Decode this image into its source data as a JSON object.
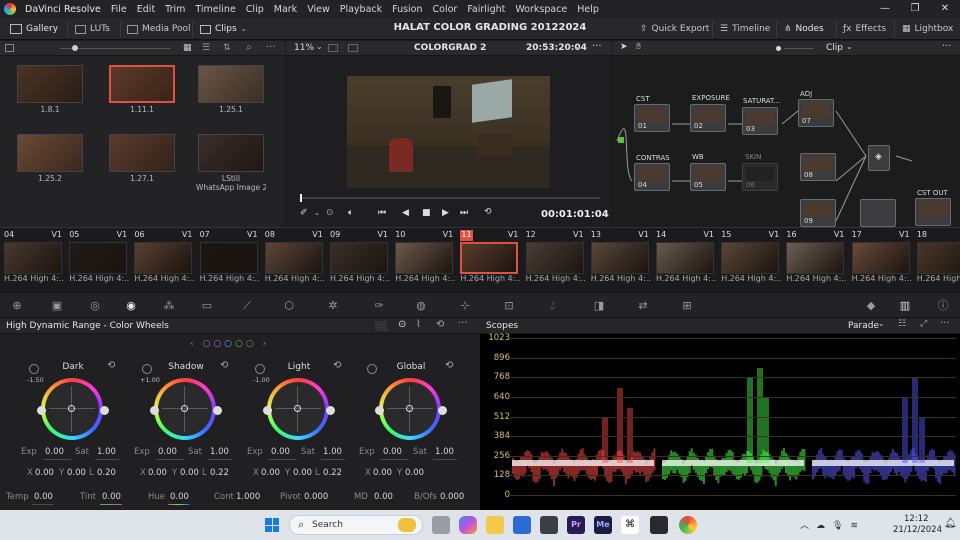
{
  "menubar": {
    "app_name": "DaVinci Resolve",
    "items": [
      "File",
      "Edit",
      "Trim",
      "Timeline",
      "Clip",
      "Mark",
      "View",
      "Playback",
      "Fusion",
      "Color",
      "Fairlight",
      "Workspace",
      "Help"
    ]
  },
  "toolbar": {
    "gallery": "Gallery",
    "luts": "LUTs",
    "media_pool": "Media Pool",
    "clips": "Clips",
    "project_title": "HALAT COLOR GRADING  20122024",
    "quick_export": "Quick Export",
    "timeline": "Timeline",
    "nodes": "Nodes",
    "effects": "Effects",
    "lightbox": "Lightbox"
  },
  "gallery": {
    "stills": [
      {
        "label": "1.8.1",
        "selected": false
      },
      {
        "label": "1.11.1",
        "selected": true
      },
      {
        "label": "1.25.1",
        "selected": false
      },
      {
        "label": "1.25.2",
        "selected": false
      },
      {
        "label": "1.27.1",
        "selected": false
      },
      {
        "label": "LStill\nWhatsApp Image 2...",
        "selected": false
      }
    ],
    "still_line1": "LStill",
    "still_line2": "WhatsApp Image 2..."
  },
  "viewer": {
    "zoom": "11%",
    "timeline_name": "COLORGRAD 2",
    "timecode_top": "20:53:20:04",
    "timecode": "00:01:01:04"
  },
  "nodes": {
    "mode": "Clip",
    "list": [
      {
        "label": "CST",
        "num": "01"
      },
      {
        "label": "EXPOSURE",
        "num": "02"
      },
      {
        "label": "SATURAT...",
        "num": "03"
      },
      {
        "label": "ADJ",
        "num": "07"
      },
      {
        "label": "CONTRAS",
        "num": "04"
      },
      {
        "label": "WB",
        "num": "05"
      },
      {
        "label": "SKIN",
        "num": "06"
      },
      {
        "label": "",
        "num": "08"
      },
      {
        "label": "",
        "num": "09"
      },
      {
        "label": "CST OUT",
        "num": ""
      }
    ]
  },
  "clips": [
    {
      "num": "04",
      "track": "V1",
      "label": "H.264 High 4:..."
    },
    {
      "num": "05",
      "track": "V1",
      "label": "H.264 High 4:..."
    },
    {
      "num": "06",
      "track": "V1",
      "label": "H.264 High 4:..."
    },
    {
      "num": "07",
      "track": "V1",
      "label": "H.264 High 4:..."
    },
    {
      "num": "08",
      "track": "V1",
      "label": "H.264 High 4:..."
    },
    {
      "num": "09",
      "track": "V1",
      "label": "H.264 High 4:..."
    },
    {
      "num": "10",
      "track": "V1",
      "label": "H.264 High 4:..."
    },
    {
      "num": "11",
      "track": "V1",
      "label": "H.264 High 4:..."
    },
    {
      "num": "12",
      "track": "V1",
      "label": "H.264 High 4:..."
    },
    {
      "num": "13",
      "track": "V1",
      "label": "H.264 High 4:..."
    },
    {
      "num": "14",
      "track": "V1",
      "label": "H.264 High 4:..."
    },
    {
      "num": "15",
      "track": "V1",
      "label": "H.264 High 4:..."
    },
    {
      "num": "16",
      "track": "V1",
      "label": "H.264 High 4:..."
    },
    {
      "num": "17",
      "track": "V1",
      "label": "H.264 High 4:..."
    },
    {
      "num": "18",
      "track": "V1",
      "label": "H.264 High 4:..."
    }
  ],
  "wheels_panel": {
    "title": "High Dynamic Range - Color Wheels",
    "wheels": [
      {
        "name": "Dark",
        "zone": "-1.50",
        "exp": "0.00",
        "sat": "1.00",
        "x": "0.00",
        "y": "0.00",
        "z": "0.20"
      },
      {
        "name": "Shadow",
        "zone": "+1.00",
        "exp": "0.00",
        "sat": "1.00",
        "x": "0.00",
        "y": "0.00",
        "z": "0.22"
      },
      {
        "name": "Light",
        "zone": "-1.00",
        "exp": "0.00",
        "sat": "1.00",
        "x": "0.00",
        "y": "0.00",
        "z": "0.22"
      },
      {
        "name": "Global",
        "zone": "",
        "exp": "0.00",
        "sat": "1.00",
        "x": "0.00",
        "y": "0.00",
        "z": ""
      }
    ],
    "labels": {
      "exp": "Exp",
      "sat": "Sat",
      "x": "X",
      "y": "Y",
      "z": "L"
    },
    "bottom": {
      "temp_label": "Temp",
      "temp": "0.00",
      "tint_label": "Tint",
      "tint": "0.00",
      "hue_label": "Hue",
      "hue": "0.00",
      "cont_label": "Cont",
      "cont": "1.000",
      "pivot_label": "Pivot",
      "pivot": "0.000",
      "md_label": "MD",
      "md": "0.00",
      "bofs_label": "B/Ofs",
      "bofs": "0.000"
    }
  },
  "scopes": {
    "title": "Scopes",
    "mode": "Parade",
    "scale": [
      "1023",
      "896",
      "768",
      "640",
      "512",
      "384",
      "256",
      "128",
      "0"
    ],
    "colors": {
      "red": "#ff4a4a",
      "green": "#4aff4a",
      "blue": "#5a5aff"
    }
  },
  "taskbar": {
    "search": "Search",
    "time": "12:12",
    "date": "21/12/2024"
  }
}
